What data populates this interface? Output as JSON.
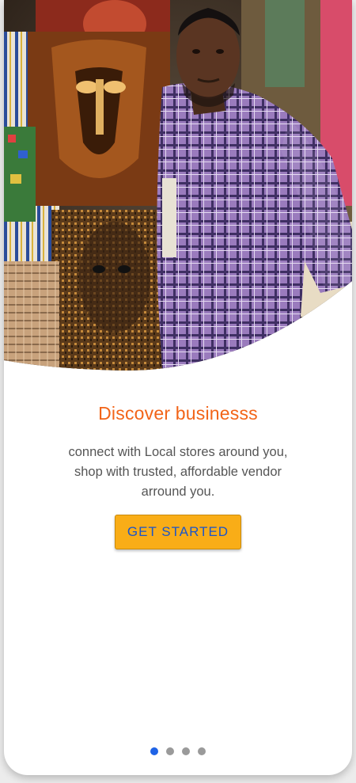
{
  "hero": {
    "image_alt": "Vendor standing in a shop with African art paintings"
  },
  "onboarding": {
    "title": "Discover businesss",
    "description": "connect with Local stores around you, shop with trusted, affordable vendor arround you.",
    "cta_label": "GET STARTED"
  },
  "pager": {
    "total": 4,
    "active_index": 0
  },
  "colors": {
    "title": "#f26418",
    "button_bg": "#f9ad17",
    "button_text": "#1b55c9",
    "dot_active": "#1f63e6",
    "dot_inactive": "#9a9a9a"
  }
}
